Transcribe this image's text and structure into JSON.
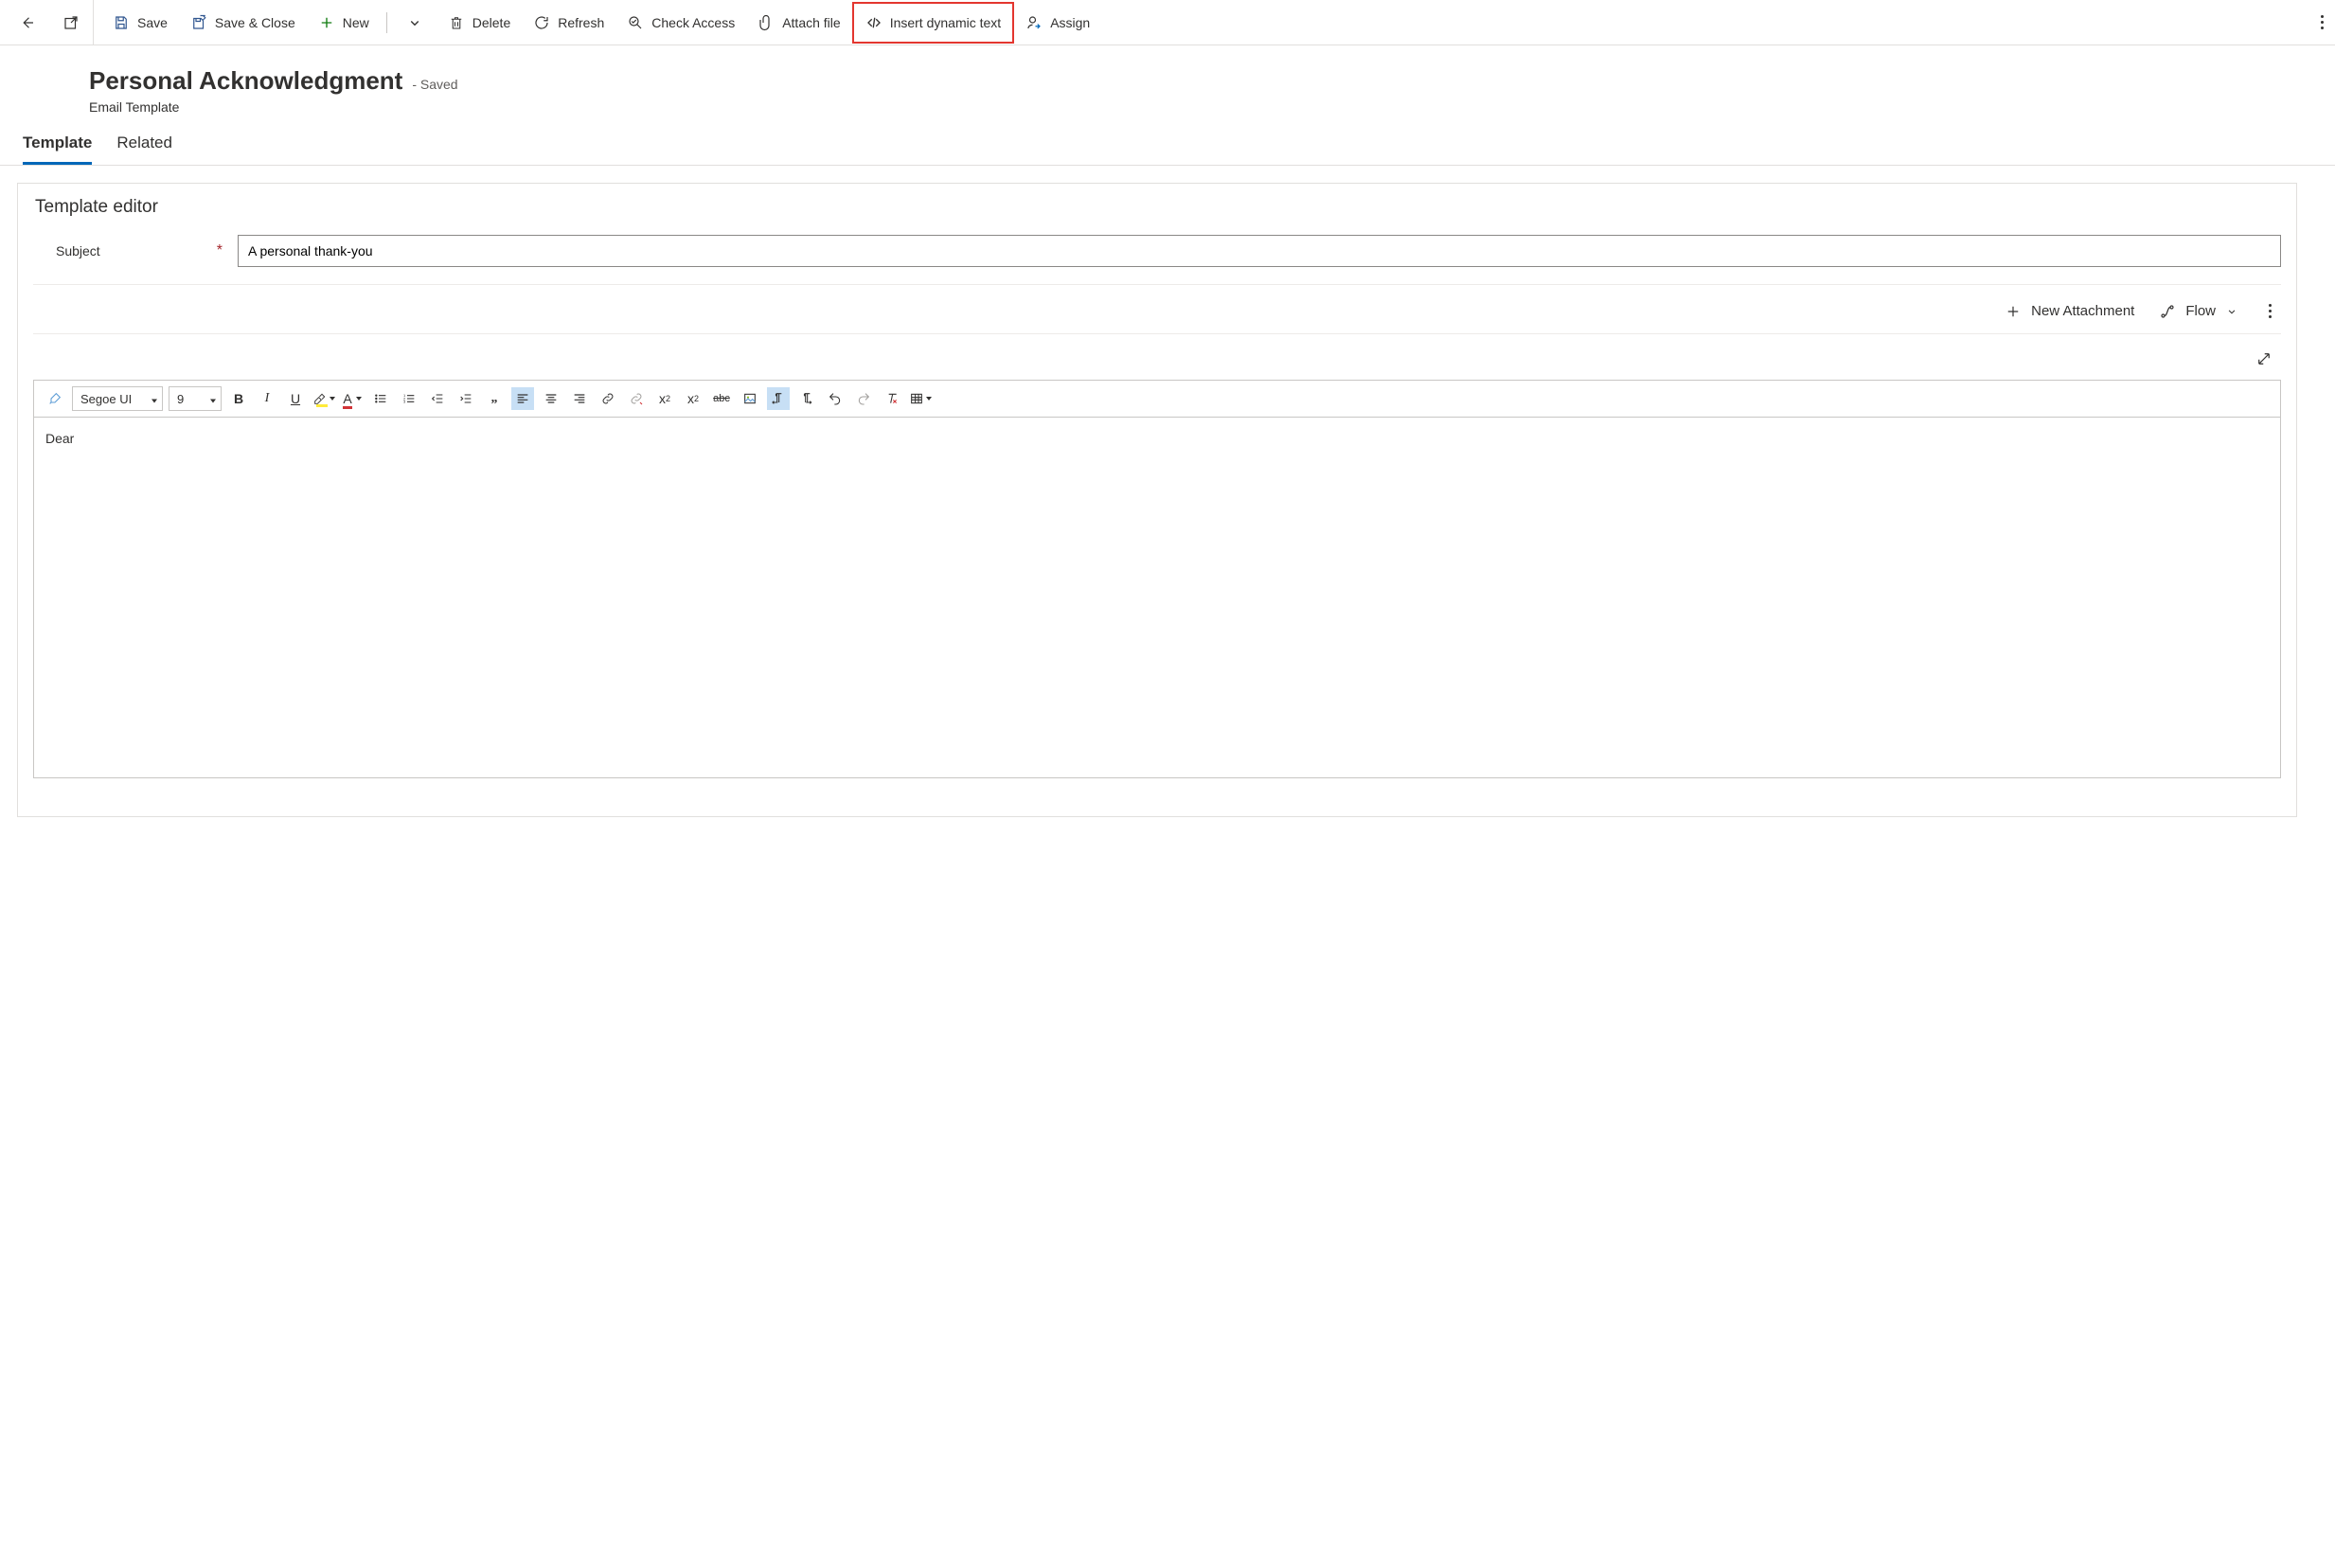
{
  "commandBar": {
    "save": "Save",
    "saveClose": "Save & Close",
    "new": "New",
    "delete": "Delete",
    "refresh": "Refresh",
    "checkAccess": "Check Access",
    "attachFile": "Attach file",
    "insertDynamic": "Insert dynamic text",
    "assign": "Assign"
  },
  "header": {
    "title": "Personal Acknowledgment",
    "state": "- Saved",
    "entity": "Email Template"
  },
  "tabs": {
    "template": "Template",
    "related": "Related"
  },
  "editor": {
    "sectionTitle": "Template editor",
    "subjectLabel": "Subject",
    "subjectValue": "A personal thank-you",
    "newAttachment": "New Attachment",
    "flow": "Flow",
    "fontName": "Segoe UI",
    "fontSize": "9",
    "bodyText": "Dear"
  }
}
